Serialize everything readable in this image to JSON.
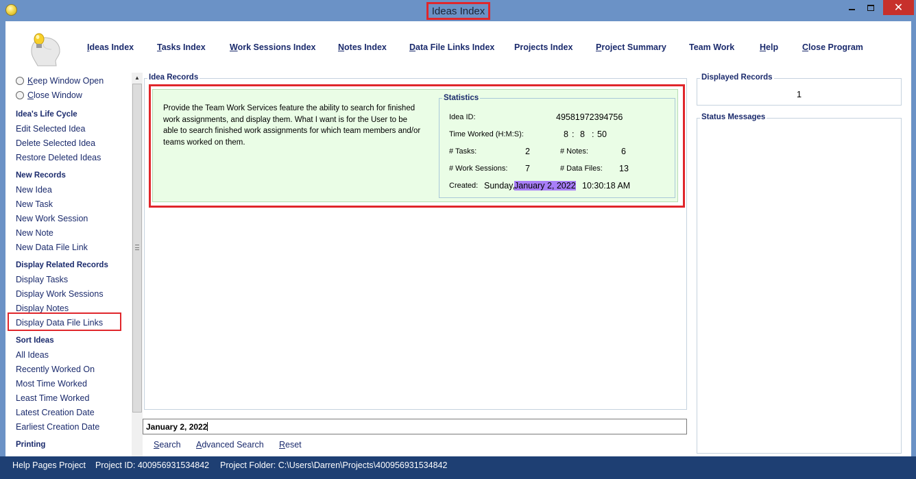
{
  "window": {
    "title": "Ideas Index",
    "close_glyph": "✕"
  },
  "nav": [
    {
      "name": "nav-ideas-index",
      "ul": "I",
      "rest": "deas Index"
    },
    {
      "name": "nav-tasks-index",
      "ul": "T",
      "rest": "asks Index"
    },
    {
      "name": "nav-work-sessions-index",
      "ul": "W",
      "rest": "ork Sessions Index"
    },
    {
      "name": "nav-notes-index",
      "ul": "N",
      "rest": "otes Index"
    },
    {
      "name": "nav-data-file-links-index",
      "ul": "D",
      "rest": "ata File Links Index"
    },
    {
      "name": "nav-projects-index",
      "ul": "",
      "rest": "Projects Index"
    },
    {
      "name": "nav-project-summary",
      "ul": "P",
      "rest": "roject Summary"
    },
    {
      "name": "nav-team-work",
      "ul": "",
      "rest": "Team Work"
    },
    {
      "name": "nav-help",
      "ul": "H",
      "rest": "elp"
    },
    {
      "name": "nav-close-program",
      "ul": "C",
      "rest": "lose Program"
    }
  ],
  "sidebar": {
    "keep_window_open_ul": "K",
    "keep_window_open_rest": "eep Window Open",
    "close_window_ul": "C",
    "close_window_rest": "lose Window",
    "life_cycle": {
      "heading": "Idea's Life Cycle",
      "items": [
        "Edit Selected Idea",
        "Delete Selected Idea",
        "Restore Deleted Ideas"
      ]
    },
    "new_records": {
      "heading": "New Records",
      "items": [
        "New Idea",
        "New Task",
        "New Work Session",
        "New Note",
        "New Data File Link"
      ]
    },
    "related": {
      "heading": "Display Related Records",
      "items": [
        "Display Tasks",
        "Display Work Sessions",
        "Display Notes",
        "Display Data File Links"
      ]
    },
    "sort": {
      "heading": "Sort Ideas",
      "items": [
        "All Ideas",
        "Recently Worked On",
        "Most Time Worked",
        "Least Time Worked",
        "Latest Creation Date",
        "Earliest Creation Date"
      ]
    },
    "printing": {
      "heading": "Printing"
    }
  },
  "records": {
    "group_title": "Idea Records",
    "idea": {
      "description": "Provide the Team Work Services feature the ability to search for finished work assignments, and display them. What I want is for the User to be able to search finished work assignments for which team members and/or teams worked on them.",
      "stats_title": "Statistics",
      "id_label": "Idea ID:",
      "id_value": "49581972394756",
      "time_label": "Time Worked (H:M:S):",
      "time_h": "8",
      "time_m": "8",
      "time_s": "50",
      "sep": ":",
      "tasks_label": "# Tasks:",
      "tasks_value": "2",
      "notes_label": "# Notes:",
      "notes_value": "6",
      "sessions_label": "# Work Sessions:",
      "sessions_value": "7",
      "files_label": "# Data Files:",
      "files_value": "13",
      "created_label": "Created:",
      "created_day": "Sunday,",
      "created_date": "January 2, 2022",
      "created_time": "10:30:18 AM"
    }
  },
  "search": {
    "value": "January 2, 2022",
    "search_ul": "S",
    "search_rest": "earch",
    "advanced_ul": "A",
    "advanced_rest": "dvanced Search",
    "reset_ul": "R",
    "reset_rest": "eset"
  },
  "right": {
    "displayed_title": "Displayed Records",
    "displayed_count": "1",
    "status_title": "Status Messages"
  },
  "statusbar": {
    "project": "Help Pages Project",
    "project_id": "Project ID:  400956931534842",
    "folder": "Project Folder:  C:\\Users\\Darren\\Projects\\400956931534842"
  }
}
